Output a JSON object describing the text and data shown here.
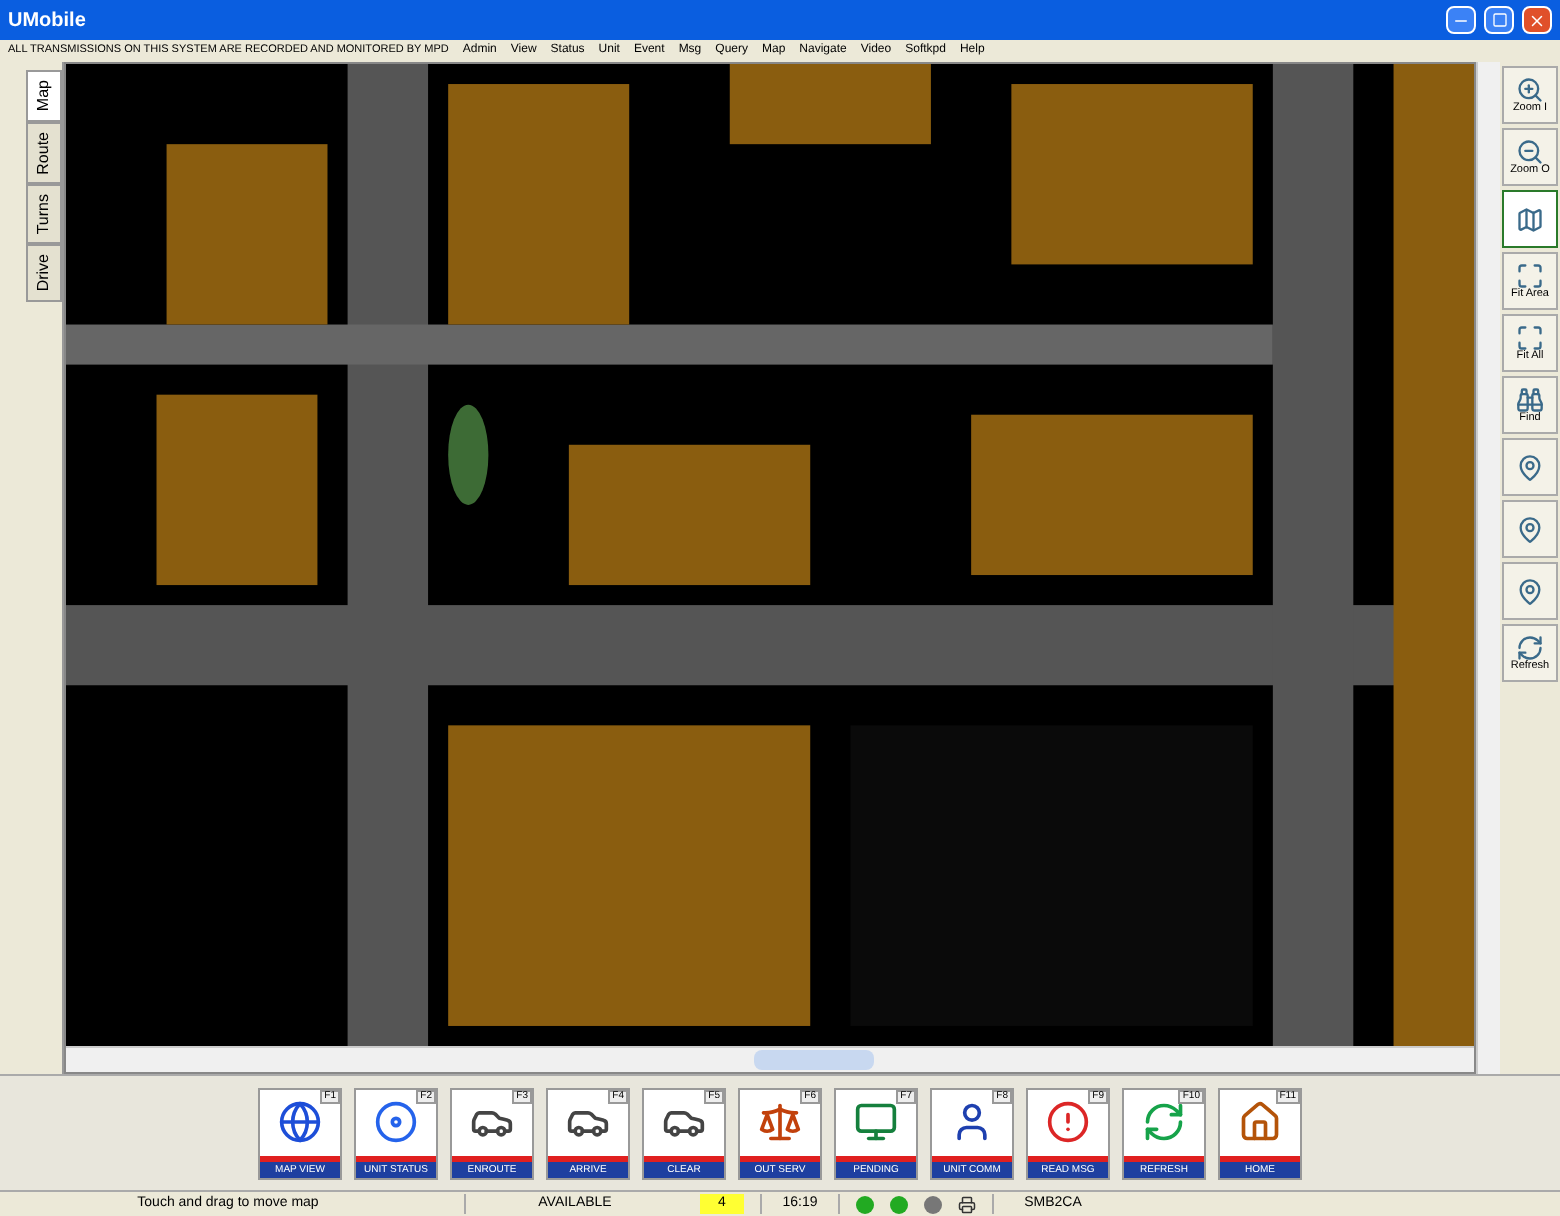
{
  "window": {
    "title": "UMobile"
  },
  "banner": "ALL TRANSMISSIONS ON THIS SYSTEM ARE RECORDED AND MONITORED BY MPD",
  "menu": [
    "Admin",
    "View",
    "Status",
    "Unit",
    "Event",
    "Msg",
    "Query",
    "Map",
    "Navigate",
    "Video",
    "Softkpd",
    "Help"
  ],
  "side_tabs": [
    {
      "label": "Map",
      "selected": true
    },
    {
      "label": "Route",
      "selected": false
    },
    {
      "label": "Turns",
      "selected": false
    },
    {
      "label": "Drive",
      "selected": false
    }
  ],
  "tools": [
    {
      "label": "Zoom I",
      "selected": false
    },
    {
      "label": "Zoom O",
      "selected": false
    },
    {
      "selected": true
    },
    {
      "label": "Fit Area",
      "selected": false
    },
    {
      "label": "Fit All",
      "selected": false
    },
    {
      "label": "Find",
      "selected": false
    },
    {
      "selected": false
    },
    {
      "selected": false
    },
    {
      "selected": false
    },
    {
      "label": "Refresh",
      "selected": false
    }
  ],
  "actions": [
    {
      "label": "MAP VIEW",
      "key": "F1"
    },
    {
      "label": "UNIT STATUS",
      "key": "F2"
    },
    {
      "label": "ENROUTE",
      "key": "F3"
    },
    {
      "label": "ARRIVE",
      "key": "F4"
    },
    {
      "label": "CLEAR",
      "key": "F5"
    },
    {
      "label": "OUT SERV",
      "key": "F6"
    },
    {
      "label": "PENDING",
      "key": "F7"
    },
    {
      "label": "UNIT COMM",
      "key": "F8"
    },
    {
      "label": "READ MSG",
      "key": "F9"
    },
    {
      "label": "REFRESH",
      "key": "F10"
    },
    {
      "label": "HOME",
      "key": "F11"
    }
  ],
  "status_bar": {
    "hint": "Touch and drag to move map",
    "status": "AVAILABLE",
    "count": "4",
    "time": "16:19",
    "lights": [
      {
        "color": "#22aa22"
      },
      {
        "color": "#22aa22"
      },
      {
        "color": "#777777"
      }
    ],
    "unit": "SMB2CA"
  }
}
